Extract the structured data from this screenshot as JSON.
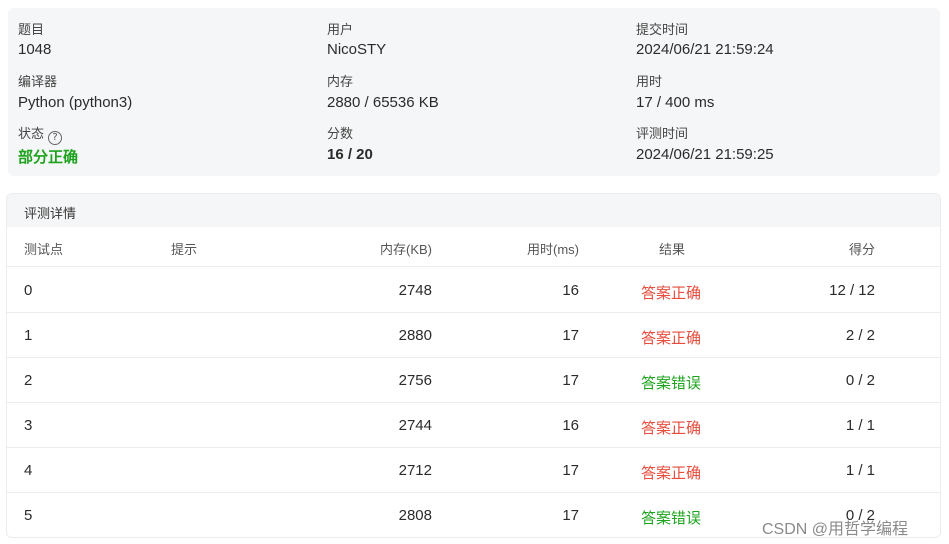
{
  "summary": {
    "problem_label": "题目",
    "problem_value": "1048",
    "user_label": "用户",
    "user_value": "NicoSTY",
    "submit_time_label": "提交时间",
    "submit_time_value": "2024/06/21 21:59:24",
    "compiler_label": "编译器",
    "compiler_value": "Python (python3)",
    "memory_label": "内存",
    "memory_value": "2880 / 65536 KB",
    "time_label": "用时",
    "time_value": "17 / 400 ms",
    "status_label": "状态",
    "status_help_icon": "?",
    "status_value": "部分正确",
    "score_label": "分数",
    "score_value": "16 / 20",
    "judge_time_label": "评测时间",
    "judge_time_value": "2024/06/21 21:59:25"
  },
  "details": {
    "title": "评测详情",
    "headers": {
      "testcase": "测试点",
      "hint": "提示",
      "memory": "内存(KB)",
      "time": "用时(ms)",
      "result": "结果",
      "score": "得分"
    },
    "rows": [
      {
        "id": "0",
        "hint": "",
        "memory": "2748",
        "time": "16",
        "result": "答案正确",
        "score": "12 / 12"
      },
      {
        "id": "1",
        "hint": "",
        "memory": "2880",
        "time": "17",
        "result": "答案正确",
        "score": "2 / 2"
      },
      {
        "id": "2",
        "hint": "",
        "memory": "2756",
        "time": "17",
        "result": "答案错误",
        "score": "0 / 2"
      },
      {
        "id": "3",
        "hint": "",
        "memory": "2744",
        "time": "16",
        "result": "答案正确",
        "score": "1 / 1"
      },
      {
        "id": "4",
        "hint": "",
        "memory": "2712",
        "time": "17",
        "result": "答案正确",
        "score": "1 / 1"
      },
      {
        "id": "5",
        "hint": "",
        "memory": "2808",
        "time": "17",
        "result": "答案错误",
        "score": "0 / 2"
      }
    ]
  },
  "colors": {
    "correct": "#e74c3c",
    "wrong": "#1fa31f",
    "partial_status": "#1fa31f"
  },
  "watermark": "CSDN @用哲学编程"
}
